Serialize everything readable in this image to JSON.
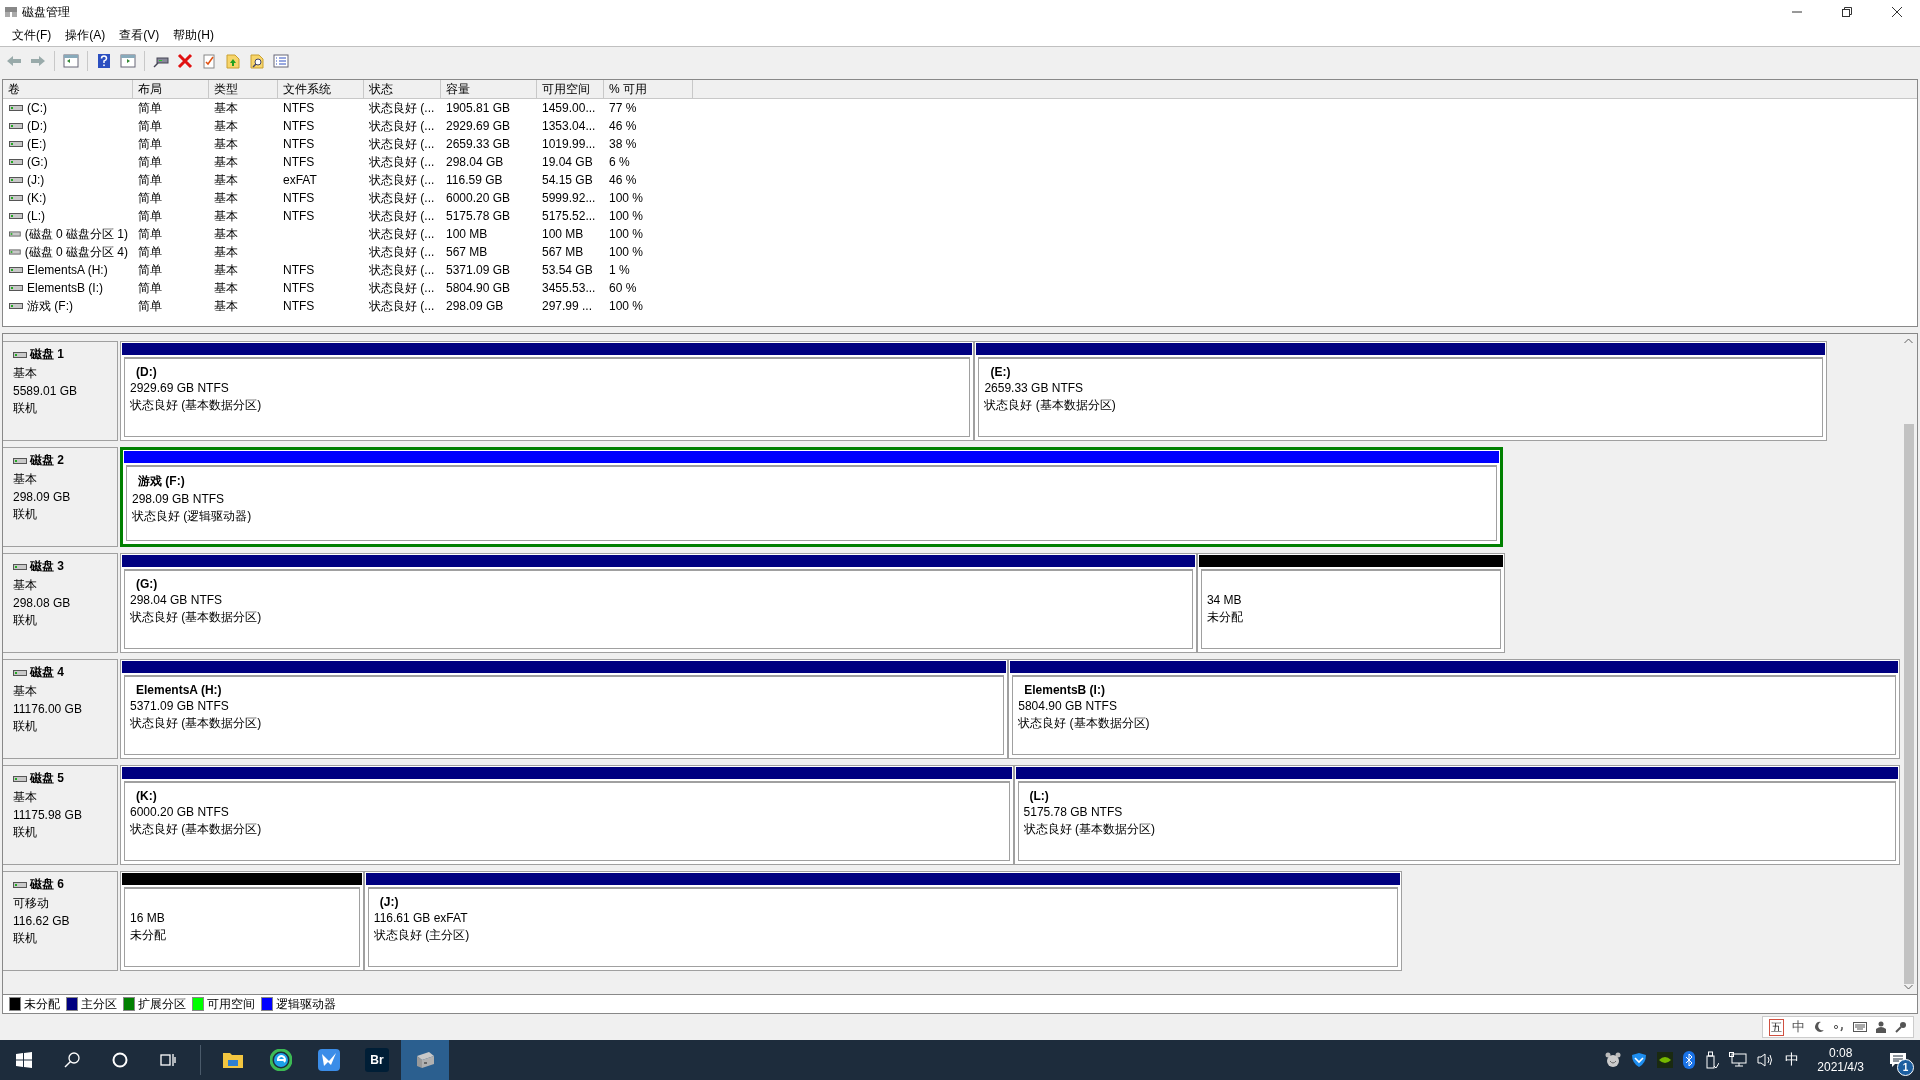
{
  "window": {
    "title": "磁盘管理"
  },
  "menu": [
    "文件(F)",
    "操作(A)",
    "查看(V)",
    "帮助(H)"
  ],
  "volume_table": {
    "columns": [
      "卷",
      "布局",
      "类型",
      "文件系统",
      "状态",
      "容量",
      "可用空间",
      "% 可用"
    ],
    "rows": [
      [
        "(C:)",
        "简单",
        "基本",
        "NTFS",
        "状态良好 (...",
        "1905.81 GB",
        "1459.00...",
        "77 %"
      ],
      [
        "(D:)",
        "简单",
        "基本",
        "NTFS",
        "状态良好 (...",
        "2929.69 GB",
        "1353.04...",
        "46 %"
      ],
      [
        "(E:)",
        "简单",
        "基本",
        "NTFS",
        "状态良好 (...",
        "2659.33 GB",
        "1019.99...",
        "38 %"
      ],
      [
        "(G:)",
        "简单",
        "基本",
        "NTFS",
        "状态良好 (...",
        "298.04 GB",
        "19.04 GB",
        "6 %"
      ],
      [
        "(J:)",
        "简单",
        "基本",
        "exFAT",
        "状态良好 (...",
        "116.59 GB",
        "54.15 GB",
        "46 %"
      ],
      [
        "(K:)",
        "简单",
        "基本",
        "NTFS",
        "状态良好 (...",
        "6000.20 GB",
        "5999.92...",
        "100 %"
      ],
      [
        "(L:)",
        "简单",
        "基本",
        "NTFS",
        "状态良好 (...",
        "5175.78 GB",
        "5175.52...",
        "100 %"
      ],
      [
        "(磁盘 0 磁盘分区 1)",
        "简单",
        "基本",
        "",
        "状态良好 (...",
        "100 MB",
        "100 MB",
        "100 %"
      ],
      [
        "(磁盘 0 磁盘分区 4)",
        "简单",
        "基本",
        "",
        "状态良好 (...",
        "567 MB",
        "567 MB",
        "100 %"
      ],
      [
        "ElementsA (H:)",
        "简单",
        "基本",
        "NTFS",
        "状态良好 (...",
        "5371.09 GB",
        "53.54 GB",
        "1 %"
      ],
      [
        "ElementsB (I:)",
        "简单",
        "基本",
        "NTFS",
        "状态良好 (...",
        "5804.90 GB",
        "3455.53...",
        "60 %"
      ],
      [
        "游戏 (F:)",
        "简单",
        "基本",
        "NTFS",
        "状态良好 (...",
        "298.09 GB",
        "297.99 ...",
        "100 %"
      ]
    ]
  },
  "disks": [
    {
      "name": "磁盘 1",
      "type": "基本",
      "size": "5589.01 GB",
      "status": "联机",
      "partitions": [
        {
          "kind": "primary",
          "name": "(D:)",
          "size": "2929.69 GB NTFS",
          "status": "状态良好 (基本数据分区)"
        },
        {
          "kind": "primary",
          "name": "(E:)",
          "size": "2659.33 GB NTFS",
          "status": "状态良好 (基本数据分区)"
        }
      ]
    },
    {
      "name": "磁盘 2",
      "type": "基本",
      "size": "298.09 GB",
      "status": "联机",
      "partitions": [
        {
          "kind": "logical",
          "name": "游戏  (F:)",
          "size": "298.09 GB NTFS",
          "status": "状态良好 (逻辑驱动器)"
        }
      ]
    },
    {
      "name": "磁盘 3",
      "type": "基本",
      "size": "298.08 GB",
      "status": "联机",
      "partitions": [
        {
          "kind": "primary",
          "name": "(G:)",
          "size": "298.04 GB NTFS",
          "status": "状态良好 (基本数据分区)"
        },
        {
          "kind": "unallocated",
          "size": "34 MB",
          "status": "未分配"
        }
      ]
    },
    {
      "name": "磁盘 4",
      "type": "基本",
      "size": "11176.00 GB",
      "status": "联机",
      "partitions": [
        {
          "kind": "primary",
          "name": "ElementsA  (H:)",
          "size": "5371.09 GB NTFS",
          "status": "状态良好 (基本数据分区)"
        },
        {
          "kind": "primary",
          "name": "ElementsB  (I:)",
          "size": "5804.90 GB NTFS",
          "status": "状态良好 (基本数据分区)"
        }
      ]
    },
    {
      "name": "磁盘 5",
      "type": "基本",
      "size": "11175.98 GB",
      "status": "联机",
      "partitions": [
        {
          "kind": "primary",
          "name": "(K:)",
          "size": "6000.20 GB NTFS",
          "status": "状态良好 (基本数据分区)"
        },
        {
          "kind": "primary",
          "name": "(L:)",
          "size": "5175.78 GB NTFS",
          "status": "状态良好 (基本数据分区)"
        }
      ]
    },
    {
      "name": "磁盘 6",
      "type": "可移动",
      "size": "116.62 GB",
      "status": "联机",
      "partitions": [
        {
          "kind": "unallocated",
          "size": "16 MB",
          "status": "未分配"
        },
        {
          "kind": "primary",
          "name": "(J:)",
          "size": "116.61 GB exFAT",
          "status": "状态良好 (主分区)"
        }
      ]
    }
  ],
  "legend": [
    {
      "label": "未分配",
      "color": "#000000"
    },
    {
      "label": "主分区",
      "color": "#000080"
    },
    {
      "label": "扩展分区",
      "color": "#008000"
    },
    {
      "label": "可用空间",
      "color": "#00ff00"
    },
    {
      "label": "逻辑驱动器",
      "color": "#0000ff"
    }
  ],
  "ime_bar": {
    "mode_key": "五",
    "language": "中"
  },
  "taskbar": {
    "app_label": "Br",
    "ime": "中",
    "time": "0:08",
    "date": "2021/4/3",
    "notification_count": "1"
  }
}
